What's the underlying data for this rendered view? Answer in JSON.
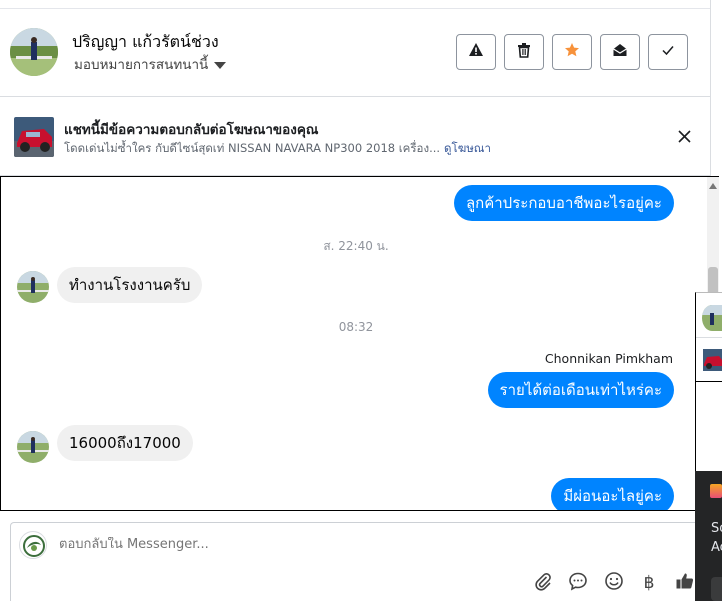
{
  "header": {
    "name": "ปริญญา แก้วรัตน์ช่วง",
    "assign_label": "มอบหมายการสนทนานี้"
  },
  "ad": {
    "title": "แชทนี้มีข้อความตอบกลับต่อโฆษณาของคุณ",
    "description": "โดดเด่นไม่ซ้ำใคร กับดีไซน์สุดเท่ NISSAN NAVARA NP300 2018 เครื่อง...",
    "link_label": "ดูโฆษณา"
  },
  "messages": {
    "m1": "ลูกค้าประกอบอาชีพอะไรอยู่คะ",
    "ts1": "ส. 22:40 น.",
    "m2": "ทำงานโรงงานครับ",
    "ts2": "08:32",
    "sender": "Chonnikan Pimkham",
    "m3": "รายได้ต่อเดือนเท่าไหร่คะ",
    "m4": "16000ถึง17000",
    "m5": "มีผ่อนอะไลยู่คะ"
  },
  "composer": {
    "placeholder": "ตอบกลับใน Messenger..."
  },
  "side_panel": {
    "line1": "So",
    "line2": "Ac"
  },
  "colors": {
    "accent_blue": "#0084ff",
    "star_orange": "#f7923b",
    "link_blue": "#385898"
  }
}
